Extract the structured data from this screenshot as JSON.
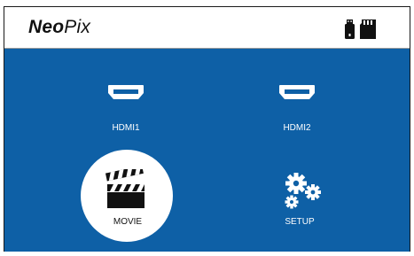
{
  "header": {
    "brand_bold": "Neo",
    "brand_regular": "Pix",
    "icons": [
      "usb-drive-icon",
      "sd-card-icon"
    ]
  },
  "menu": {
    "selected": "movie",
    "items": [
      {
        "id": "hdmi1",
        "label": "HDMI1",
        "icon": "hdmi-icon"
      },
      {
        "id": "hdmi2",
        "label": "HDMI2",
        "icon": "hdmi-icon"
      },
      {
        "id": "movie",
        "label": "MOVIE",
        "icon": "clapperboard-icon"
      },
      {
        "id": "setup",
        "label": "SETUP",
        "icon": "gears-icon"
      }
    ]
  },
  "colors": {
    "background_blue": "#0e60a6",
    "selected_circle": "#ffffff",
    "text_on_blue": "#ffffff",
    "text_on_white": "#111111"
  }
}
